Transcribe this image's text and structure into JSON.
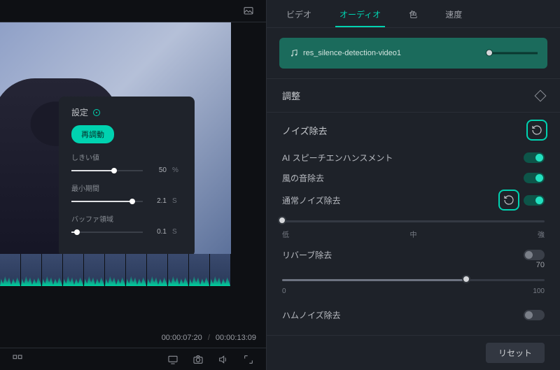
{
  "tabs": {
    "video": "ビデオ",
    "audio": "オーディオ",
    "color": "色",
    "speed": "速度"
  },
  "audio_clip": {
    "name": "res_silence-detection-video1"
  },
  "sections": {
    "adjust": "調整",
    "denoise": "ノイズ除去"
  },
  "toggles": {
    "ai_speech": "AI スピーチエンハンスメント",
    "wind": "風の音除去",
    "normal": "通常ノイズ除去",
    "reverb": "リバーブ除去",
    "hum": "ハムノイズ除去"
  },
  "level_labels": {
    "low": "低",
    "mid": "中",
    "high": "強"
  },
  "reverb_scale": {
    "min": "0",
    "max": "100",
    "value": "70"
  },
  "settings_popup": {
    "title": "設定",
    "reanalyze": "再調動",
    "threshold": {
      "label": "しきい値",
      "value": "50",
      "unit": "%"
    },
    "min_duration": {
      "label": "最小期間",
      "value": "2.1",
      "unit": "S"
    },
    "buffer": {
      "label": "バッファ領域",
      "value": "0.1",
      "unit": "S"
    }
  },
  "time": {
    "current": "00:00:07:20",
    "total": "00:00:13:09"
  },
  "footer": {
    "reset": "リセット"
  }
}
